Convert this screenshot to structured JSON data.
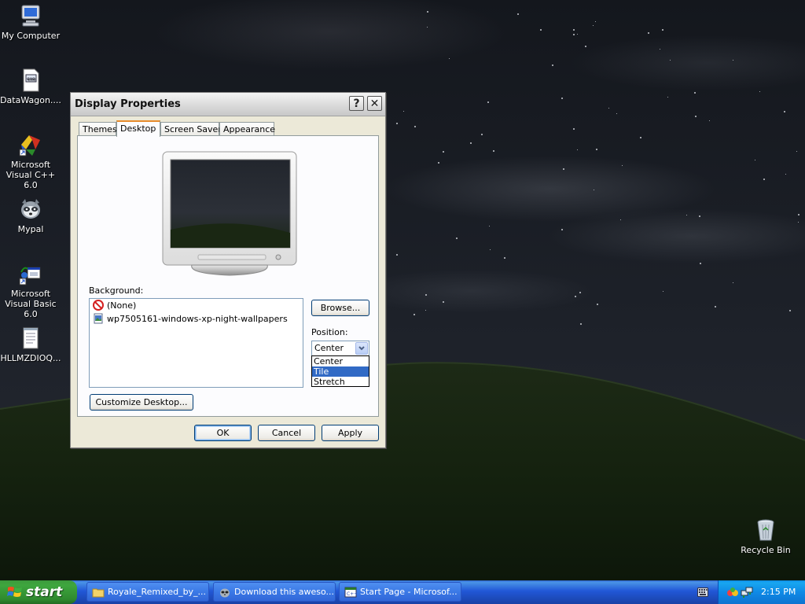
{
  "desktop": {
    "icons": [
      {
        "label": "My Computer",
        "icon": "my-computer-icon"
      },
      {
        "label": "DataWagon....",
        "icon": "datawagon-document-icon"
      },
      {
        "label": "Microsoft Visual C++ 6.0",
        "icon": "visual-cpp-icon"
      },
      {
        "label": "Mypal",
        "icon": "mypal-browser-icon"
      },
      {
        "label": "Microsoft Visual Basic 6.0",
        "icon": "visual-basic-icon"
      },
      {
        "label": "HLLMZDIOQ...",
        "icon": "notepad-document-icon"
      },
      {
        "label": "Recycle Bin",
        "icon": "recycle-bin-icon"
      }
    ]
  },
  "window": {
    "title": "Display Properties",
    "help_glyph": "?",
    "close_glyph": "✕",
    "tabs": [
      "Themes",
      "Desktop",
      "Screen Saver",
      "Appearance"
    ],
    "active_tab": "Desktop",
    "background_label": "Background:",
    "background_items": [
      "(None)",
      "wp7505161-windows-xp-night-wallpapers"
    ],
    "browse_label": "Browse...",
    "position_label": "Position:",
    "position_value": "Center",
    "position_options": [
      "Center",
      "Tile",
      "Stretch"
    ],
    "position_highlighted": "Tile",
    "customize_label": "Customize Desktop...",
    "ok_label": "OK",
    "cancel_label": "Cancel",
    "apply_label": "Apply"
  },
  "taskbar": {
    "start_label": "start",
    "tasks": [
      {
        "label": "Royale_Remixed_by_...",
        "icon": "folder-icon"
      },
      {
        "label": "Download this aweso...",
        "icon": "mypal-browser-icon"
      },
      {
        "label": "Start Page - Microsof...",
        "icon": "visual-cpp-icon"
      }
    ],
    "clock": "2:15 PM"
  },
  "colors": {
    "taskbar_blue": "#2157d7",
    "start_green": "#3ea63e",
    "tray_blue": "#0f8ae6",
    "selection_blue": "#316ac5",
    "dialog_face": "#ece9d8",
    "tab_accent": "#e68b2c"
  }
}
